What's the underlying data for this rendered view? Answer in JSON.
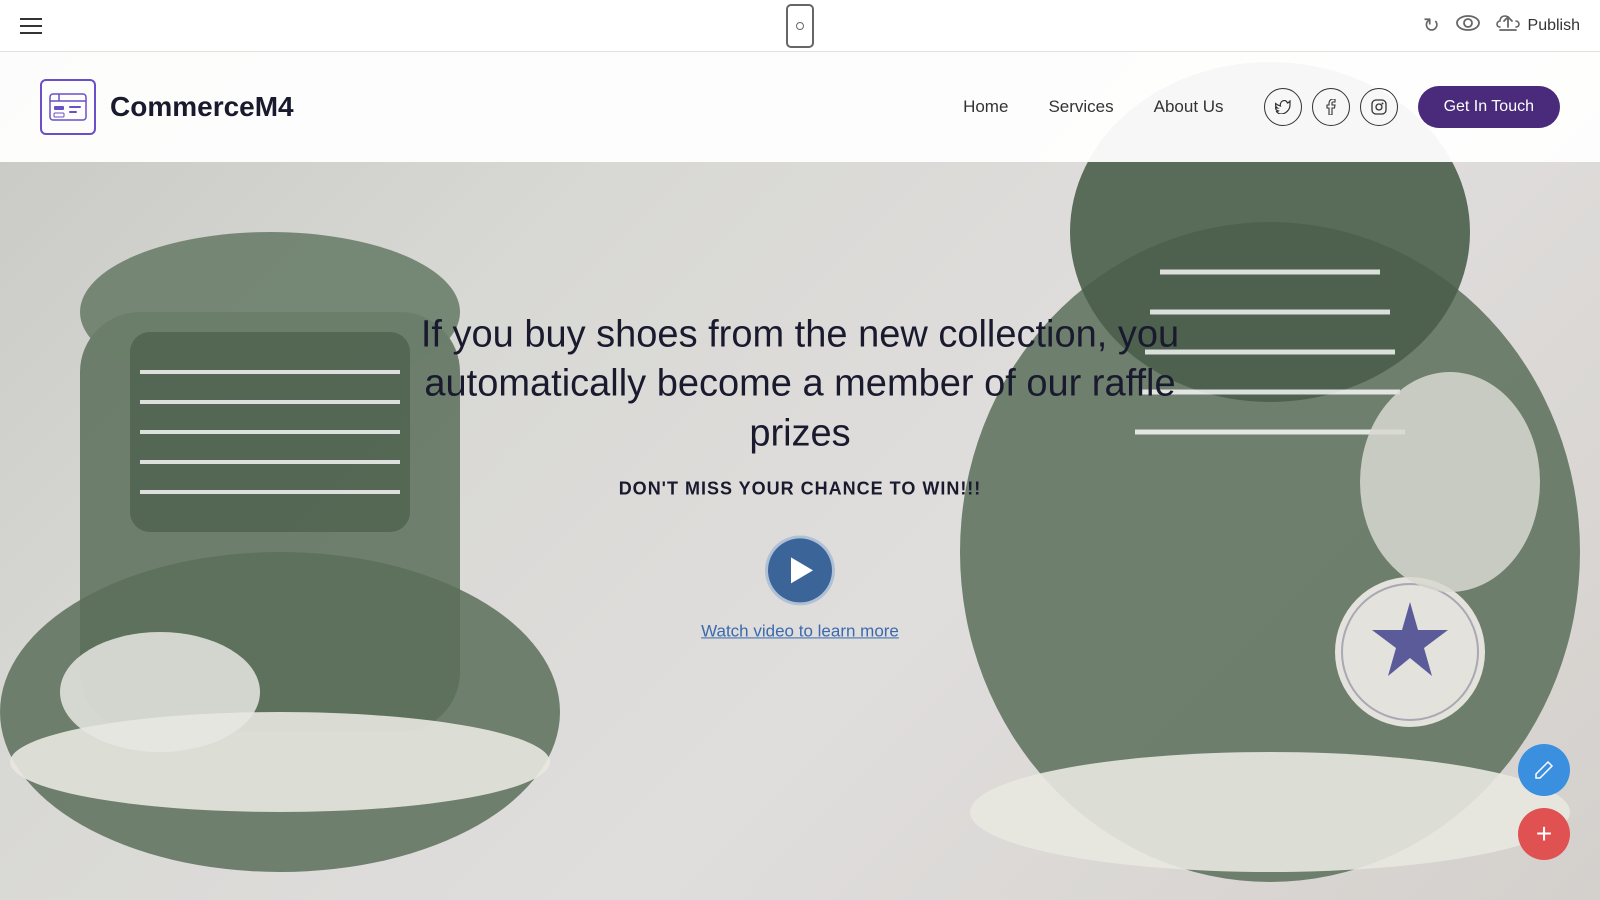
{
  "toolbar": {
    "publish_label": "Publish"
  },
  "site": {
    "logo_text": "CommerceM4",
    "nav": {
      "home": "Home",
      "services": "Services",
      "about_us": "About Us",
      "get_in_touch": "Get In Touch"
    },
    "hero": {
      "title": "If you buy shoes from the new collection, you automatically become a member of our raffle prizes",
      "subtitle": "DON'T MISS YOUR CHANCE TO WIN!!!",
      "watch_video": "Watch video to learn more"
    }
  }
}
